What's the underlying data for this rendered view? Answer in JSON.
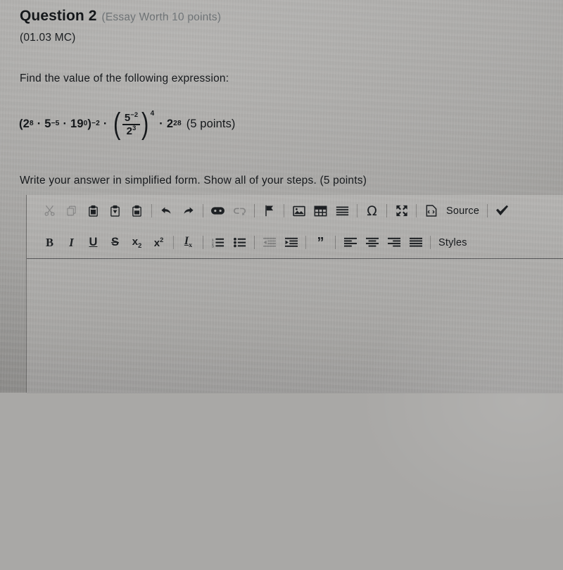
{
  "question": {
    "title": "Question 2",
    "subtitle": "(Essay Worth 10 points)",
    "code": "(01.03 MC)",
    "prompt": "Find the value of the following expression:",
    "instruction": "Write your answer in simplified form. Show all of your steps. (5 points)"
  },
  "expression": {
    "group_open": "(",
    "t1_base": "2",
    "t1_exp": "8",
    "dot1": "·",
    "t2_base": "5",
    "t2_exp": "−5",
    "dot2": "·",
    "t3_base": "19",
    "t3_exp": "0",
    "group_close": ")",
    "group_exp": "−2",
    "dot3": "·",
    "paren_open": "(",
    "num_base": "5",
    "num_exp": "−2",
    "den_base": "2",
    "den_exp": "3",
    "paren_close": ")",
    "paren_exp": "4",
    "dot4": "·",
    "t4_base": "2",
    "t4_exp": "28",
    "points": "(5 points)",
    "plain": "(2^8 · 5^-5 · 19^0)^-2 · (5^-2 / 2^3)^4 · 2^28 (5 points)"
  },
  "editor": {
    "toolbar_row1": [
      {
        "name": "cut",
        "label": "Cut",
        "disabled": true
      },
      {
        "name": "copy",
        "label": "Copy",
        "disabled": true
      },
      {
        "name": "paste",
        "label": "Paste",
        "disabled": false
      },
      {
        "name": "paste-as-plain-text",
        "label": "Paste as plain text",
        "disabled": false
      },
      {
        "name": "paste-from-word",
        "label": "Paste from Word",
        "disabled": false
      },
      {
        "name": "undo",
        "label": "Undo",
        "disabled": false
      },
      {
        "name": "redo",
        "label": "Redo",
        "disabled": false
      },
      {
        "name": "link",
        "label": "Link",
        "disabled": false
      },
      {
        "name": "unlink",
        "label": "Unlink",
        "disabled": true
      },
      {
        "name": "anchor",
        "label": "Anchor",
        "disabled": false
      },
      {
        "name": "image",
        "label": "Image",
        "disabled": false
      },
      {
        "name": "table",
        "label": "Table",
        "disabled": false
      },
      {
        "name": "horizontal-rule",
        "label": "Insert Horizontal Line",
        "disabled": false
      },
      {
        "name": "special-character",
        "label": "Insert Special Character",
        "disabled": false
      },
      {
        "name": "maximize",
        "label": "Maximize",
        "disabled": false
      },
      {
        "name": "source",
        "label": "Source",
        "disabled": false
      },
      {
        "name": "spell-check",
        "label": "Spell Check As You Type",
        "disabled": false
      }
    ],
    "toolbar_row2": [
      {
        "name": "bold",
        "label": "B",
        "disabled": false
      },
      {
        "name": "italic",
        "label": "I",
        "disabled": false
      },
      {
        "name": "underline",
        "label": "U",
        "disabled": false
      },
      {
        "name": "strikethrough",
        "label": "S",
        "disabled": false
      },
      {
        "name": "subscript",
        "label": "x",
        "disabled": false
      },
      {
        "name": "superscript",
        "label": "x",
        "disabled": false
      },
      {
        "name": "remove-format",
        "label": "I",
        "disabled": false
      },
      {
        "name": "numbered-list",
        "label": "Insert/Remove Numbered List",
        "disabled": false
      },
      {
        "name": "bulleted-list",
        "label": "Insert/Remove Bulleted List",
        "disabled": false
      },
      {
        "name": "outdent",
        "label": "Decrease Indent",
        "disabled": true
      },
      {
        "name": "indent",
        "label": "Increase Indent",
        "disabled": false
      },
      {
        "name": "blockquote",
        "label": "Block Quote",
        "disabled": false
      },
      {
        "name": "align-left",
        "label": "Align Left",
        "disabled": false
      },
      {
        "name": "align-center",
        "label": "Center",
        "disabled": false
      },
      {
        "name": "align-right",
        "label": "Align Right",
        "disabled": false
      },
      {
        "name": "justify",
        "label": "Justify",
        "disabled": false
      },
      {
        "name": "styles",
        "label": "Styles",
        "disabled": false
      }
    ],
    "source_label": "Source",
    "styles_label": "Styles",
    "body_value": "",
    "body_placeholder": ""
  },
  "colors": {
    "background": "#a9a8a6",
    "text": "#16191c",
    "muted_text": "#6f7477",
    "toolbar_bg": "#b0afad",
    "divider": "#58585a"
  }
}
